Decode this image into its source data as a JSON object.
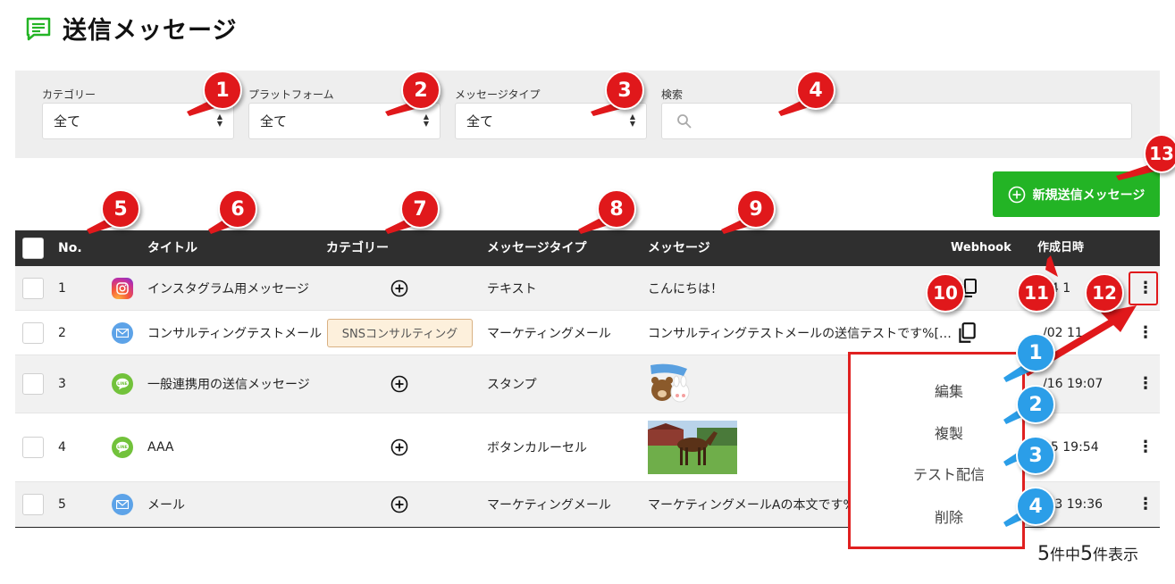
{
  "page": {
    "title": "送信メッセージ",
    "icon": "message-list-icon",
    "accent": "#23b425"
  },
  "filters": {
    "category": {
      "label": "カテゴリー",
      "value": "全て"
    },
    "platform": {
      "label": "プラットフォーム",
      "value": "全て"
    },
    "message_type": {
      "label": "メッセージタイプ",
      "value": "全て"
    },
    "search": {
      "label": "検索",
      "placeholder": ""
    }
  },
  "new_button": {
    "label": "新規送信メッセージ",
    "color": "#23b425"
  },
  "table": {
    "headers": {
      "no": "No.",
      "title": "タイトル",
      "category": "カテゴリー",
      "type": "メッセージタイプ",
      "message": "メッセージ",
      "webhook": "Webhook",
      "created": "作成日時"
    },
    "rows": [
      {
        "no": "1",
        "platform": "instagram-icon",
        "title": "インスタグラム用メッセージ",
        "category": "",
        "type": "テキスト",
        "message": "こんにちは！",
        "created": "04 1"
      },
      {
        "no": "2",
        "platform": "mail-icon",
        "title": "コンサルティングテストメール",
        "category": "SNSコンサルティング",
        "type": "マーケティングメール",
        "message": "コンサルティングテストメールの送信テストです%[…",
        "created": "/02 11"
      },
      {
        "no": "3",
        "platform": "line-icon",
        "title": "一般連携用の送信メッセージ",
        "category": "",
        "type": "スタンプ",
        "message": "",
        "created": "/16 19:07"
      },
      {
        "no": "4",
        "platform": "line-icon",
        "title": "AAA",
        "category": "",
        "type": "ボタンカルーセル",
        "message": "",
        "created": "15 19:54"
      },
      {
        "no": "5",
        "platform": "mail-icon",
        "title": "メール",
        "category": "",
        "type": "マーケティングメール",
        "message": "マーケティングメールAの本文です%[",
        "created": ".13 19:36"
      }
    ]
  },
  "footer": {
    "total": "5",
    "total_unit": "件中",
    "shown": "5",
    "shown_unit": "件表示"
  },
  "context_menu": {
    "items": [
      "編集",
      "複製",
      "テスト配信",
      "削除"
    ]
  },
  "annotations": {
    "red": [
      "1",
      "2",
      "3",
      "4",
      "5",
      "6",
      "7",
      "8",
      "9",
      "10",
      "11",
      "12",
      "13"
    ],
    "blue": [
      "1",
      "2",
      "3",
      "4"
    ]
  }
}
